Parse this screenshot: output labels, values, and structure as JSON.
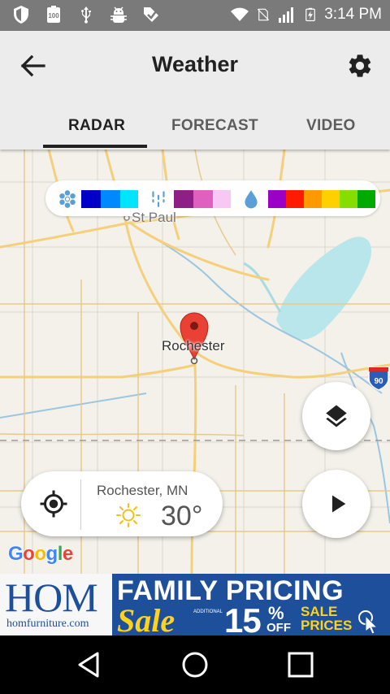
{
  "status_bar": {
    "time": "3:14 PM",
    "battery_badge": "100",
    "icons": [
      "shield-icon",
      "battery-100-icon",
      "usb-icon",
      "android-debug-icon",
      "download-check-icon",
      "wifi-icon",
      "no-sim-icon",
      "signal-icon",
      "battery-charging-icon"
    ]
  },
  "app_bar": {
    "title": "Weather",
    "back_icon": "arrow-back-icon",
    "settings_icon": "gear-icon"
  },
  "tabs": [
    {
      "label": "RADAR",
      "active": true
    },
    {
      "label": "FORECAST",
      "active": false
    },
    {
      "label": "VIDEO",
      "active": false
    }
  ],
  "legend": {
    "snow_icon": "snowflake-icon",
    "snow_colors": [
      "#0000c8",
      "#0088ff",
      "#00e5ff"
    ],
    "mix_icon": "mixed-precip-icon",
    "mix_colors": [
      "#8e1f86",
      "#e060c0",
      "#f8c8f4"
    ],
    "rain_icon": "raindrop-icon",
    "rain_colors": [
      "#9b00c8",
      "#ff1a00",
      "#ff9900",
      "#ffd000",
      "#88dd00",
      "#00aa00"
    ]
  },
  "map": {
    "labels": {
      "st_paul": "St Paul",
      "rochester": "Rochester",
      "interstate": "90"
    },
    "attribution": {
      "letters": [
        "G",
        "o",
        "o",
        "g",
        "l",
        "e"
      ],
      "colors": [
        "#4285f4",
        "#ea4335",
        "#fbbc05",
        "#4285f4",
        "#34a853",
        "#ea4335"
      ]
    }
  },
  "location_card": {
    "city": "Rochester, MN",
    "temperature": "30°",
    "condition_icon": "sun-icon",
    "locate_icon": "my-location-icon"
  },
  "buttons": {
    "layers_icon": "layers-icon",
    "play_icon": "play-icon"
  },
  "ad": {
    "brand": "HOM",
    "url": "homfurniture.com",
    "headline": "FAMILY PRICING",
    "sale": "Sale",
    "additional": "ADDITIONAL",
    "percent": "15",
    "percent_sign": "%",
    "off": "OFF",
    "sale_prices": "SALE PRICES"
  },
  "nav_bar": {
    "icons": [
      "nav-back-icon",
      "nav-home-icon",
      "nav-recents-icon"
    ]
  }
}
